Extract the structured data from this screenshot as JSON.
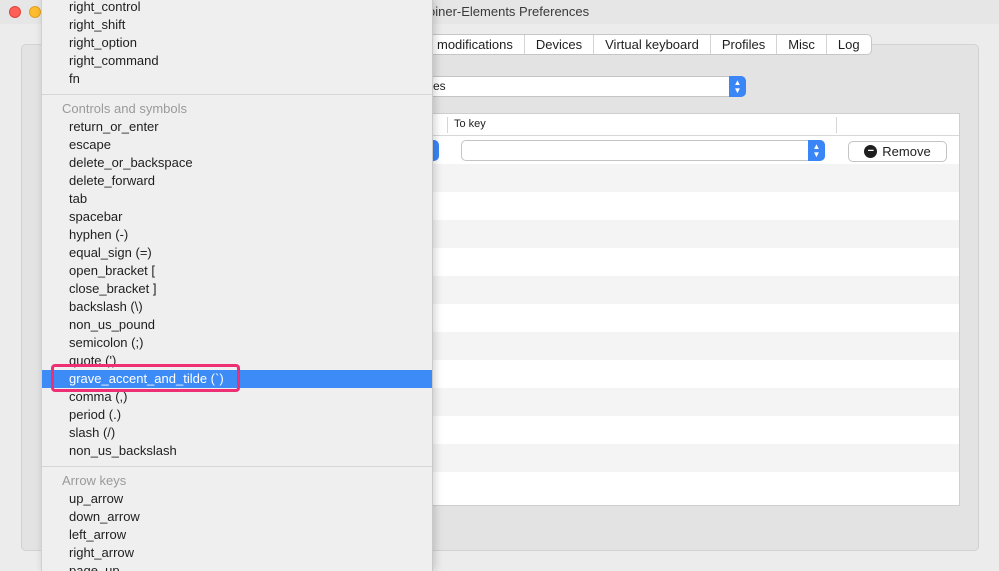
{
  "window": {
    "title": "oiner-Elements Preferences"
  },
  "tabs": [
    {
      "label": "modifications"
    },
    {
      "label": "Devices"
    },
    {
      "label": "Virtual keyboard"
    },
    {
      "label": "Profiles"
    },
    {
      "label": "Misc"
    },
    {
      "label": "Log"
    }
  ],
  "device_select": {
    "value": "es"
  },
  "table": {
    "headers": {
      "to_key": "To key"
    },
    "remove_label": "Remove",
    "remove_icon": "minus-circle-icon"
  },
  "menu": {
    "top_items": [
      "right_control",
      "right_shift",
      "right_option",
      "right_command",
      "fn"
    ],
    "controls_header": "Controls and symbols",
    "controls_items": [
      "return_or_enter",
      "escape",
      "delete_or_backspace",
      "delete_forward",
      "tab",
      "spacebar",
      "hyphen (-)",
      "equal_sign (=)",
      "open_bracket [",
      "close_bracket ]",
      "backslash (\\)",
      "non_us_pound",
      "semicolon (;)",
      "quote (')",
      "grave_accent_and_tilde (`)",
      "comma (,)",
      "period (.)",
      "slash (/)",
      "non_us_backslash"
    ],
    "selected_item": "grave_accent_and_tilde (`)",
    "arrows_header": "Arrow keys",
    "arrow_items": [
      "up_arrow",
      "down_arrow",
      "left_arrow",
      "right_arrow",
      "page_up"
    ]
  },
  "colors": {
    "selection": "#3d8bf7",
    "highlight_box": "#ee2f73",
    "select_accent": "#3b86f7"
  }
}
